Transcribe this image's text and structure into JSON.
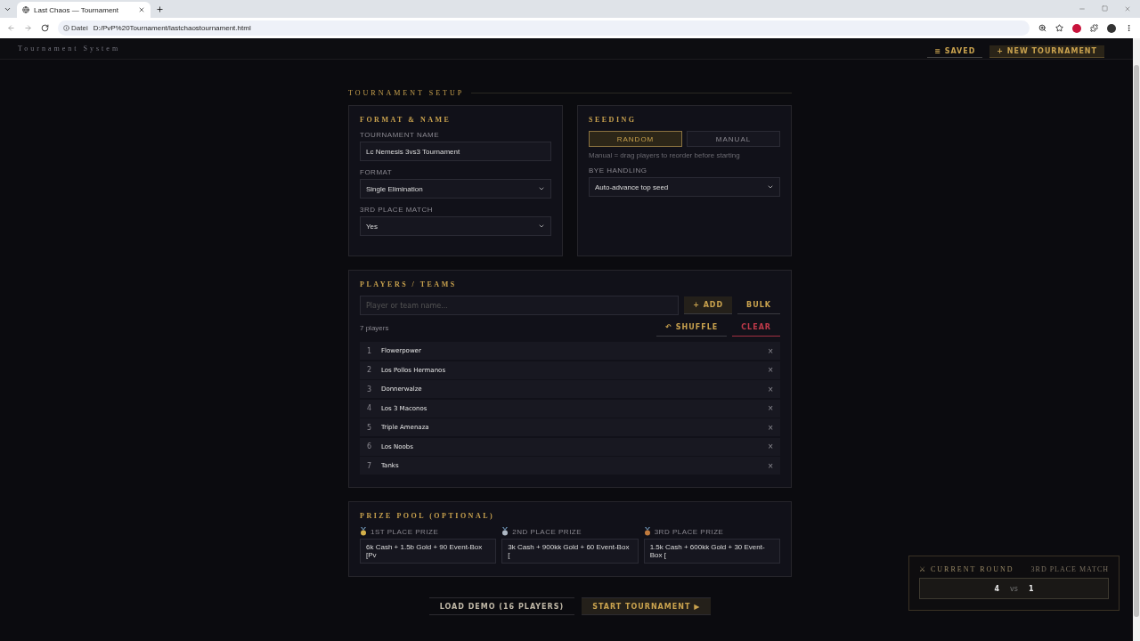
{
  "browser": {
    "tab_title": "Last Chaos — Tournament",
    "address_label": "Datei",
    "url": "D:/PvP%20Tournament/lastchaostournament.html"
  },
  "header": {
    "subtitle": "Tournament System",
    "buttons": [
      {
        "label": "≡ SAVED",
        "kind": "ghost"
      },
      {
        "label": "+ NEW TOURNAMENT",
        "kind": "gold"
      }
    ]
  },
  "section_title": "TOURNAMENT SETUP",
  "format_card": {
    "title": "FORMAT & NAME",
    "fields": [
      {
        "label": "TOURNAMENT NAME",
        "kind": "text",
        "value": "Lc Nemesis 3vs3 Tournament"
      },
      {
        "label": "FORMAT",
        "kind": "select",
        "value": "Single Elimination"
      },
      {
        "label": "3RD PLACE MATCH",
        "kind": "select",
        "value": "Yes"
      }
    ]
  },
  "seeding_card": {
    "title": "SEEDING",
    "options": [
      {
        "label": "RANDOM",
        "selected": true
      },
      {
        "label": "MANUAL",
        "selected": false
      }
    ],
    "hint": "Manual = drag players to reorder before starting",
    "bye_label": "BYE HANDLING",
    "bye_value": "Auto-advance top seed"
  },
  "players_card": {
    "title": "PLAYERS / TEAMS",
    "placeholder": "Player or team name...",
    "add": "+ ADD",
    "bulk": "BULK",
    "count": "7 players",
    "shuffle": "↶ SHUFFLE",
    "clear": "CLEAR",
    "players": [
      {
        "seed": "1",
        "name": "Flowerpower",
        "remove": "×"
      },
      {
        "seed": "2",
        "name": "Los Pollos Hermanos",
        "remove": "×"
      },
      {
        "seed": "3",
        "name": "Donnerwalze",
        "remove": "×"
      },
      {
        "seed": "4",
        "name": "Los 3 Maconos",
        "remove": "×"
      },
      {
        "seed": "5",
        "name": "Triple Amenaza",
        "remove": "×"
      },
      {
        "seed": "6",
        "name": "Los Noobs",
        "remove": "×"
      },
      {
        "seed": "7",
        "name": "Tanks",
        "remove": "×"
      }
    ]
  },
  "prize_card": {
    "title": "PRIZE POOL (OPTIONAL)",
    "prizes": [
      {
        "label": "1ST PLACE PRIZE",
        "color": "#d4b04a",
        "value": "6k Cash + 1.5b Gold + 90 Event-Box [Pv"
      },
      {
        "label": "2ND PLACE PRIZE",
        "color": "#aeb8c4",
        "value": "3k Cash + 900kk Gold + 60 Event-Box ["
      },
      {
        "label": "3RD PLACE PRIZE",
        "color": "#c07a3c",
        "value": "1.5k Cash + 600kk Gold + 30 Event-Box ["
      }
    ]
  },
  "actions": [
    {
      "label": "LOAD DEMO (16 PLAYERS)",
      "kind": "ghost"
    },
    {
      "label": "START TOURNAMENT ▶",
      "kind": "gold"
    }
  ],
  "current_round": {
    "title": "⚔ CURRENT ROUND",
    "stage": "3RD PLACE MATCH",
    "home": "4",
    "vs": "vs",
    "away": "1"
  }
}
